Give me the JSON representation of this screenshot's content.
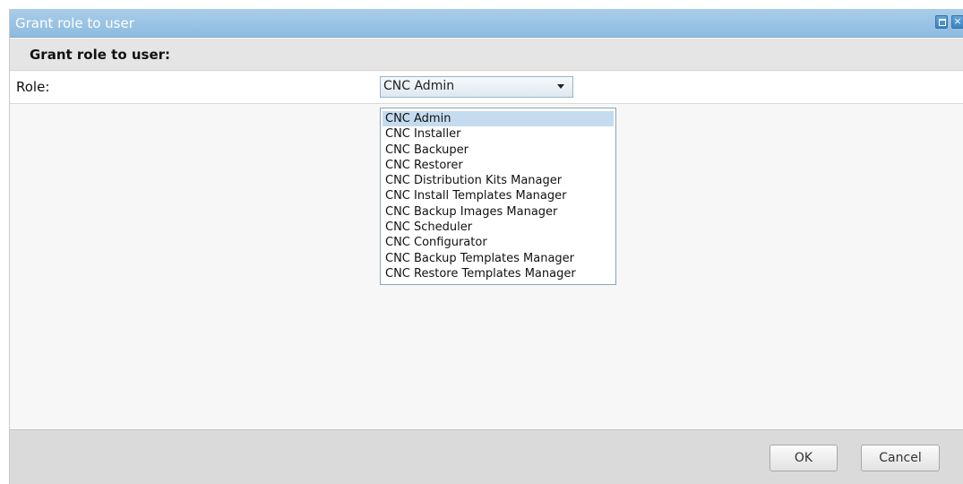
{
  "window": {
    "title": "Grant role to user",
    "maximize_icon": "maximize-icon",
    "close_icon": "close-icon",
    "close_glyph": "×"
  },
  "section": {
    "header": "Grant role to user:"
  },
  "form": {
    "role_label": "Role:",
    "role_selected": "CNC Admin"
  },
  "dropdown": {
    "options": [
      "CNC Admin",
      "CNC Installer",
      "CNC Backuper",
      "CNC Restorer",
      "CNC Distribution Kits Manager",
      "CNC Install Templates Manager",
      "CNC Backup Images Manager",
      "CNC Scheduler",
      "CNC Configurator",
      "CNC Backup Templates Manager",
      "CNC Restore Templates Manager"
    ],
    "highlighted": "CNC Admin"
  },
  "footer": {
    "ok_label": "OK",
    "cancel_label": "Cancel"
  },
  "colors": {
    "titlebar": "#99c4e6",
    "highlight": "#c5dbef"
  }
}
